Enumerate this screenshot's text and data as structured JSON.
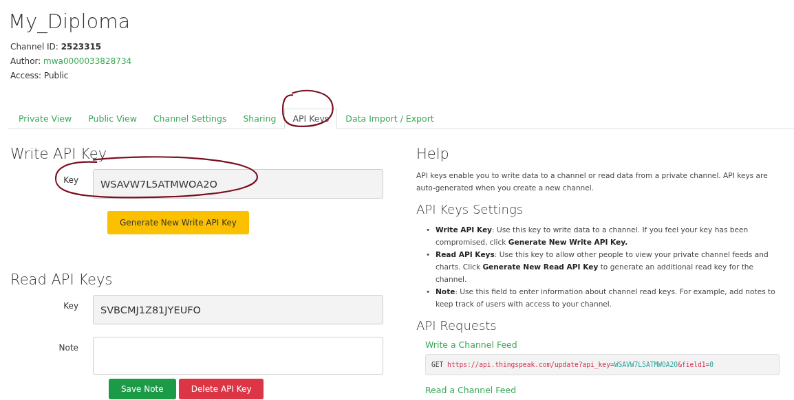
{
  "title": "My_Diploma",
  "meta": [
    {
      "label": "Channel ID:",
      "value": "2523315",
      "kind": "bold"
    },
    {
      "label": "Author:",
      "value": "mwa0000033828734",
      "kind": "link"
    },
    {
      "label": "Access:",
      "value": "Public",
      "kind": "plain"
    }
  ],
  "tabs": [
    {
      "label": "Private View",
      "selected": false,
      "circled": false
    },
    {
      "label": "Public View",
      "selected": false,
      "circled": false
    },
    {
      "label": "Channel Settings",
      "selected": false,
      "circled": false
    },
    {
      "label": "Sharing",
      "selected": false,
      "circled": false
    },
    {
      "label": "API Keys",
      "selected": true,
      "circled": true
    },
    {
      "label": "Data Import / Export",
      "selected": false,
      "circled": false
    }
  ],
  "write_key": {
    "heading": "Write API Key",
    "label": "Key",
    "value": "WSAVW7L5ATMWOA2O",
    "circled": true,
    "button": "Generate New Write API Key"
  },
  "read_keys": {
    "heading": "Read API Keys",
    "key_label": "Key",
    "value": "SVBCMJ1Z81JYEUFO",
    "note_label": "Note",
    "buttons": [
      {
        "label": "Save Note",
        "kind": "save"
      },
      {
        "label": "Delete API Key",
        "kind": "delete"
      }
    ]
  },
  "help": {
    "heading": "Help",
    "text": "API keys enable you to write data to a channel or read data from a private channel. API keys are auto-generated when you create a new channel.",
    "settings_heading": "API Keys Settings",
    "settings": [
      {
        "marker": "•",
        "text": "**Write API Key**: Use this key to write data to a channel. If you feel your key has been compromised, click **Generate New Write API Key.**"
      },
      {
        "marker": "•",
        "text": "**Read API Keys**: Use this key to allow other people to view your private channel feeds and charts. Click **Generate New Read API Key** to generate an additional read key for the channel."
      },
      {
        "marker": "•",
        "text": "**Note**: Use this field to enter information about channel read keys. For example, add notes to keep track of users with access to your channel."
      }
    ],
    "requests_heading": "API Requests",
    "requests": [
      {
        "title": "Write a Channel Feed",
        "parts": [
          {
            "text": "GET ",
            "kind": "method"
          },
          {
            "text": "https://api.thingspeak.com/update?api_key=",
            "kind": "url"
          },
          {
            "text": "WSAVW7L5ATMWOA2O",
            "kind": "value"
          },
          {
            "text": "&field1=",
            "kind": "url"
          },
          {
            "text": "0",
            "kind": "value"
          }
        ]
      },
      {
        "title": "Read a Channel Feed"
      }
    ]
  }
}
